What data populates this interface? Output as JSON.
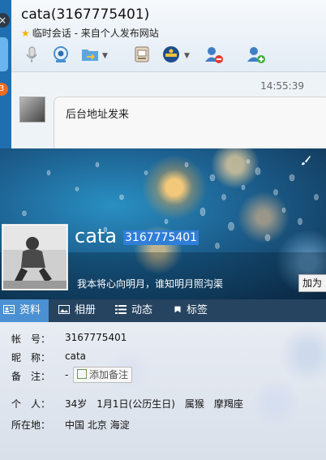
{
  "chat": {
    "title": "cata(3167775401)",
    "subtitle": "临时会话 - 来自个人发布网站",
    "badge": "3",
    "close_glyph": "×",
    "time": "14:55:39",
    "message_line1": "后台地址发来",
    "message_line2": "",
    "toolbar_icons": [
      "microphone-icon",
      "video-icon",
      "folder-transfer-icon",
      "screen-icon",
      "app-icon",
      "remove-user-icon",
      "add-user-icon"
    ]
  },
  "profile": {
    "name": "cata",
    "qq": "3167775401",
    "signature": "我本将心向明月，谁知明月照沟渠",
    "add_button": "加为",
    "tabs": [
      {
        "label": "资料",
        "icon": "profile-card-icon",
        "active": true
      },
      {
        "label": "相册",
        "icon": "photo-icon",
        "active": false
      },
      {
        "label": "动态",
        "icon": "feed-icon",
        "active": false
      },
      {
        "label": "标签",
        "icon": "bookmark-icon",
        "active": false
      }
    ],
    "fields": {
      "account_label": "帐　号：",
      "account_value": "3167775401",
      "nickname_label": "昵　称：",
      "nickname_value": "cata",
      "remark_label": "备　注：",
      "remark_value": "-",
      "remark_button": "添加备注",
      "personal_label": "个　人：",
      "personal_value": "34岁　1月1日(公历生日)　属猴　摩羯座",
      "location_label": "所在地：",
      "location_value": "中国 北京 海淀"
    }
  },
  "colors": {
    "accent": "#2f7ed8",
    "tab_active": "#4a90d2",
    "badge": "#ee6b1f"
  }
}
